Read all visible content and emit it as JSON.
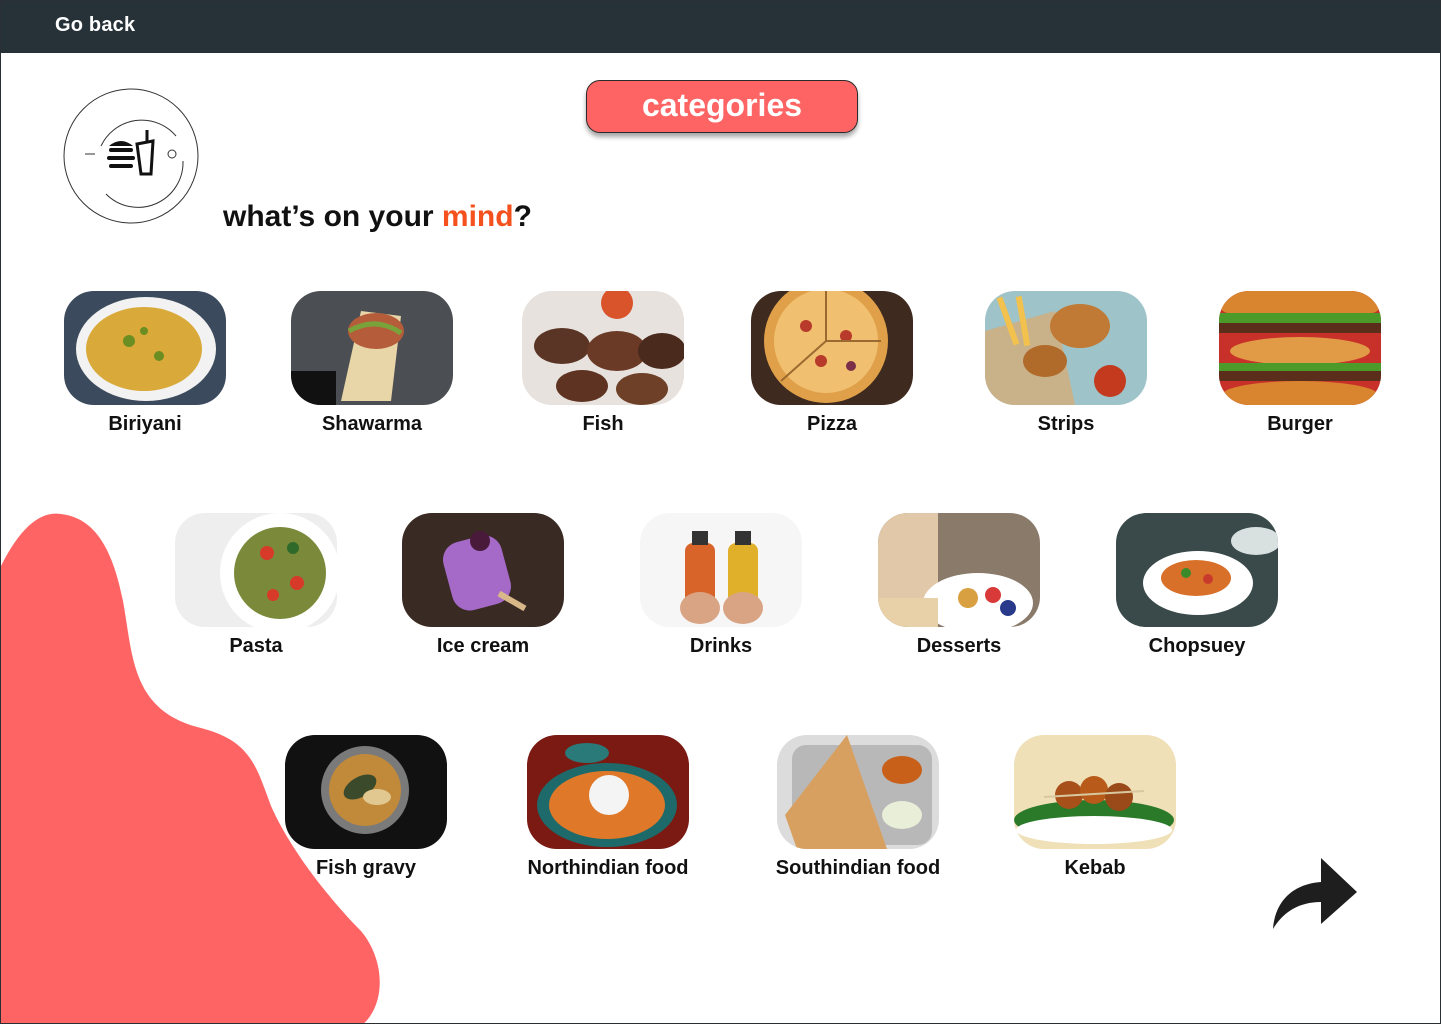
{
  "header": {
    "back_label": "Go back"
  },
  "title_button": "categories",
  "headline": {
    "prefix": "what’s on your ",
    "accent": "mind",
    "suffix": "?"
  },
  "colors": {
    "accent": "#ff6464",
    "highlight": "#f4511e",
    "topbar": "#263238"
  },
  "logo_icon": "food-logo-icon",
  "next_icon": "forward-arrow-icon",
  "categories": [
    {
      "label": "Biriyani"
    },
    {
      "label": "Shawarma"
    },
    {
      "label": "Fish"
    },
    {
      "label": "Pizza"
    },
    {
      "label": "Strips"
    },
    {
      "label": "Burger"
    },
    {
      "label": "Pasta"
    },
    {
      "label": "Ice cream"
    },
    {
      "label": "Drinks"
    },
    {
      "label": "Desserts"
    },
    {
      "label": "Chopsuey"
    },
    {
      "label": "Fish gravy"
    },
    {
      "label": "Northindian food"
    },
    {
      "label": "Southindian food"
    },
    {
      "label": "Kebab"
    }
  ]
}
